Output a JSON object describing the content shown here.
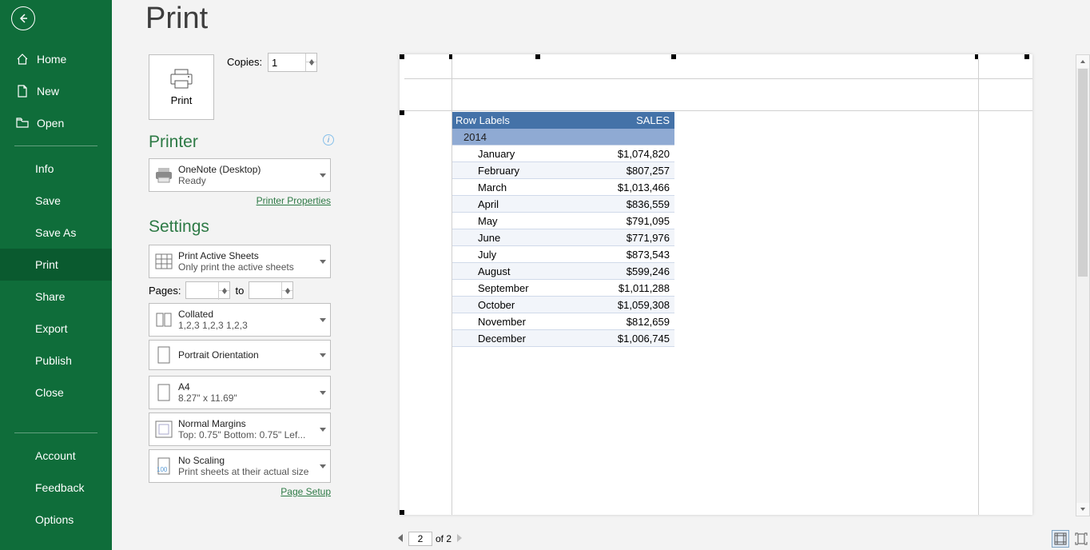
{
  "page_title": "Print",
  "sidebar": {
    "top": [
      {
        "label": "Home",
        "icon": "home"
      },
      {
        "label": "New",
        "icon": "doc"
      },
      {
        "label": "Open",
        "icon": "folder"
      }
    ],
    "mid": [
      {
        "label": "Info"
      },
      {
        "label": "Save"
      },
      {
        "label": "Save As"
      },
      {
        "label": "Print",
        "selected": true
      },
      {
        "label": "Share"
      },
      {
        "label": "Export"
      },
      {
        "label": "Publish"
      },
      {
        "label": "Close"
      }
    ],
    "bottom": [
      {
        "label": "Account"
      },
      {
        "label": "Feedback"
      },
      {
        "label": "Options"
      }
    ]
  },
  "print_button_label": "Print",
  "copies_label": "Copies:",
  "copies_value": "1",
  "printer_section": "Printer",
  "printer": {
    "name": "OneNote (Desktop)",
    "status": "Ready"
  },
  "printer_properties": "Printer Properties",
  "settings_section": "Settings",
  "settings": {
    "active_sheets": {
      "t1": "Print Active Sheets",
      "t2": "Only print the active sheets"
    },
    "pages_label": "Pages:",
    "pages_to": "to",
    "collate": {
      "t1": "Collated",
      "t2": "1,2,3    1,2,3    1,2,3"
    },
    "orientation": {
      "t1": "Portrait Orientation"
    },
    "paper": {
      "t1": "A4",
      "t2": "8.27\" x 11.69\""
    },
    "margins": {
      "t1": "Normal Margins",
      "t2": "Top: 0.75\" Bottom: 0.75\" Lef..."
    },
    "scaling": {
      "t1": "No Scaling",
      "t2": "Print sheets at their actual size"
    }
  },
  "page_setup": "Page Setup",
  "preview": {
    "header": {
      "col1": "Row Labels",
      "col2": "SALES"
    },
    "year": "2014",
    "rows": [
      {
        "m": "January",
        "v": "$1,074,820"
      },
      {
        "m": "February",
        "v": "$807,257"
      },
      {
        "m": "March",
        "v": "$1,013,466"
      },
      {
        "m": "April",
        "v": "$836,559"
      },
      {
        "m": "May",
        "v": "$791,095"
      },
      {
        "m": "June",
        "v": "$771,976"
      },
      {
        "m": "July",
        "v": "$873,543"
      },
      {
        "m": "August",
        "v": "$599,246"
      },
      {
        "m": "September",
        "v": "$1,011,288"
      },
      {
        "m": "October",
        "v": "$1,059,308"
      },
      {
        "m": "November",
        "v": "$812,659"
      },
      {
        "m": "December",
        "v": "$1,006,745"
      }
    ]
  },
  "page_nav": {
    "current": "2",
    "total_label": "of 2"
  }
}
